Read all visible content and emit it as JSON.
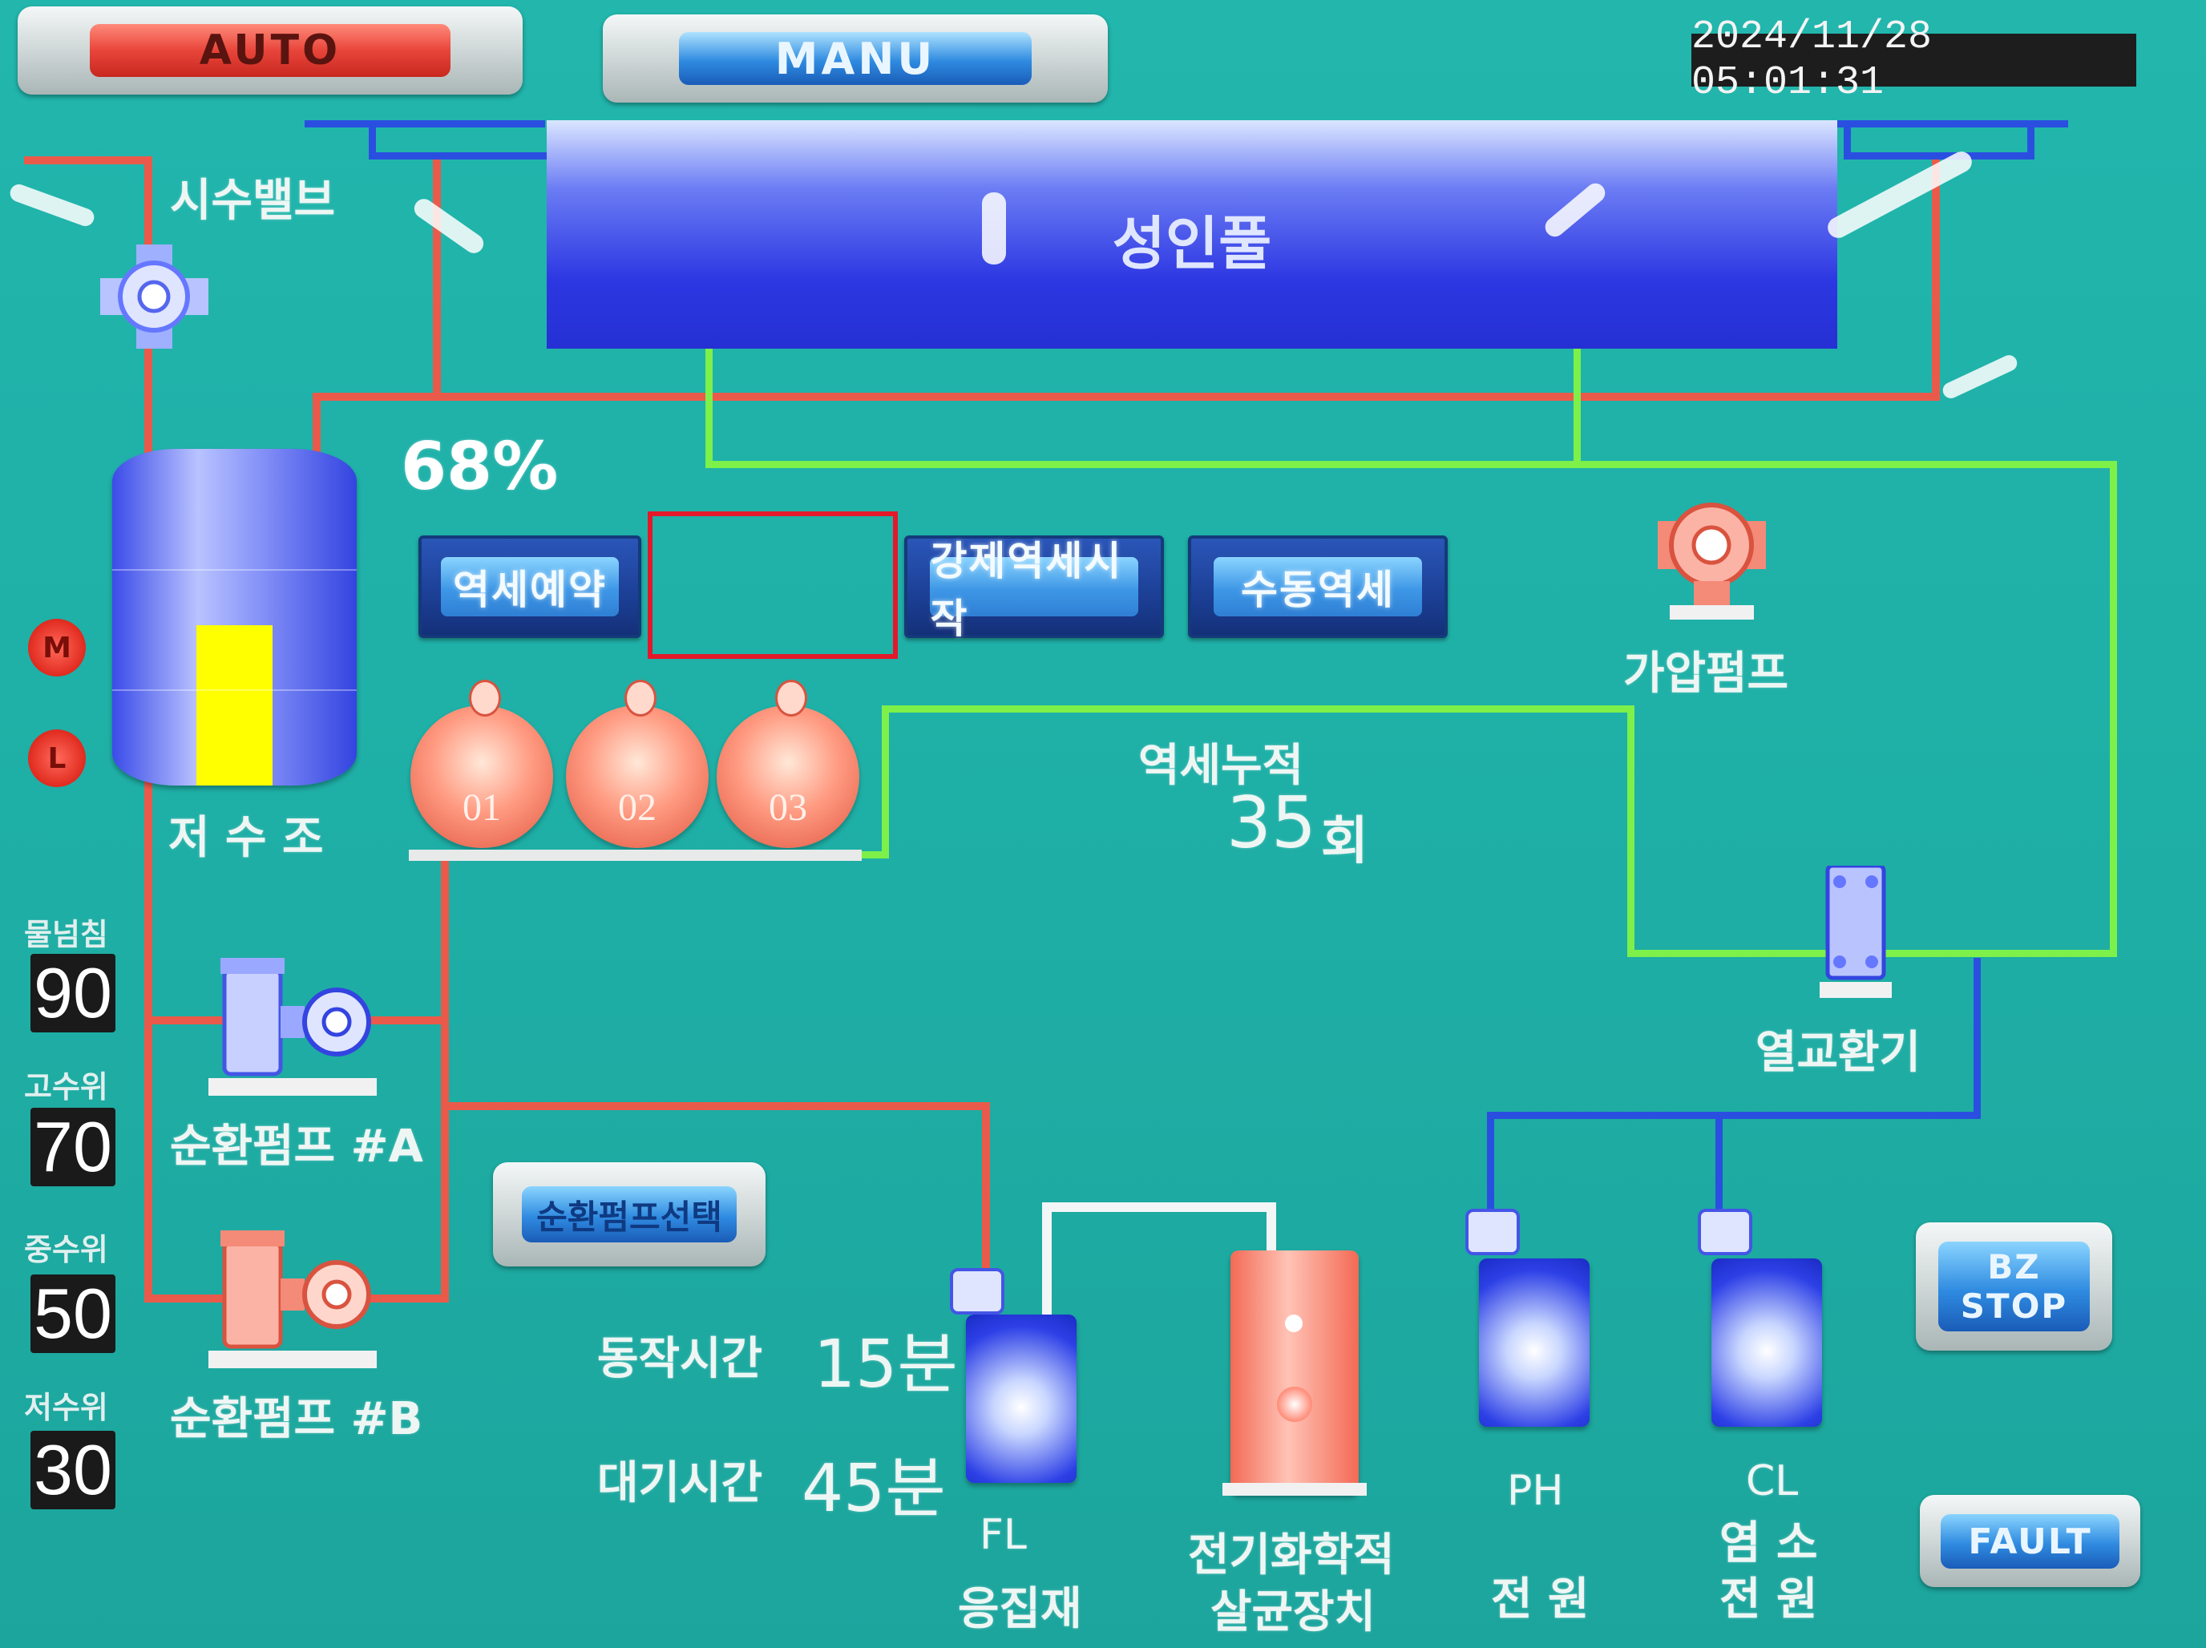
{
  "header": {
    "auto_label": "AUTO",
    "manu_label": "MANU",
    "datetime": "2024/11/28 05:01:31"
  },
  "pool": {
    "label": "성인풀"
  },
  "valve": {
    "label": "시수밸브"
  },
  "reservoir": {
    "label": "저 수 조",
    "percent_label": "68%",
    "level_fraction": 0.68,
    "m_indicator": "M",
    "l_indicator": "L"
  },
  "levels": [
    {
      "label": "물넘침",
      "value": "90"
    },
    {
      "label": "고수위",
      "value": "70"
    },
    {
      "label": "중수위",
      "value": "50"
    },
    {
      "label": "저수위",
      "value": "30"
    }
  ],
  "function_buttons": {
    "btn1": "역세예약",
    "btn3": "강제역세시작",
    "btn4": "수동역세"
  },
  "filters": [
    "01",
    "02",
    "03"
  ],
  "backwash": {
    "title": "역세누적",
    "count": "35",
    "unit": "회"
  },
  "pumps": {
    "pressure_pump": "가압펌프",
    "heat_exchanger": "열교환기",
    "circ_a": "순환펌프 #A",
    "circ_b": "순환펌프 #B",
    "circ_select": "순환펌프선택"
  },
  "timing": {
    "run_label": "동작시간",
    "run_value": "15분",
    "wait_label": "대기시간",
    "wait_value": "45분"
  },
  "equipment": {
    "fl_line1": "FL",
    "fl_line2": "응집재",
    "electro_line1": "전기화학적",
    "electro_line2": "살균장치",
    "ph_line1": "PH",
    "ph_line2": "전 원",
    "cl_line1": "CL",
    "cl_line2": "염 소",
    "cl_line3": "전 원"
  },
  "status_buttons": {
    "bz_line1": "BZ",
    "bz_line2": "STOP",
    "fault": "FAULT"
  },
  "colors": {
    "background": "#1fb1a8",
    "auto_red": "#e8453a",
    "manu_blue": "#2f8be0",
    "level_fill": "#ffff00",
    "pipe_red": "#ea5a4a",
    "pipe_green": "#7df04a",
    "pipe_blue": "#2a4fe0",
    "highlight_box": "#e3182a"
  }
}
